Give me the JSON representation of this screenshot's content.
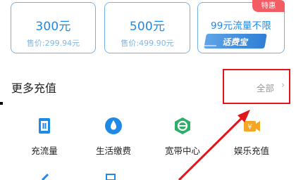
{
  "cards": [
    {
      "amount": "300元",
      "price": "售价:299.94元"
    },
    {
      "amount": "500元",
      "price": "售价:499.90元"
    },
    {
      "amount": "99元流量不限",
      "badge": "特惠",
      "stamp": "话费宝"
    }
  ],
  "section": {
    "title": "更多充值",
    "all_label": "全部",
    "chevron": "›"
  },
  "services": [
    {
      "label": "充流量",
      "icon": "data-topup-icon"
    },
    {
      "label": "生活缴费",
      "icon": "utility-payment-icon"
    },
    {
      "label": "宽带中心",
      "icon": "broadband-icon"
    },
    {
      "label": "娱乐充值",
      "icon": "entertainment-topup-icon"
    }
  ],
  "colors": {
    "accent": "#1e8ae6",
    "card_border": "#6fb3ec",
    "badge": "#f25d64",
    "highlight": "#e3141b",
    "broadband": "#2fae6a",
    "entertainment": "#f5a623"
  }
}
